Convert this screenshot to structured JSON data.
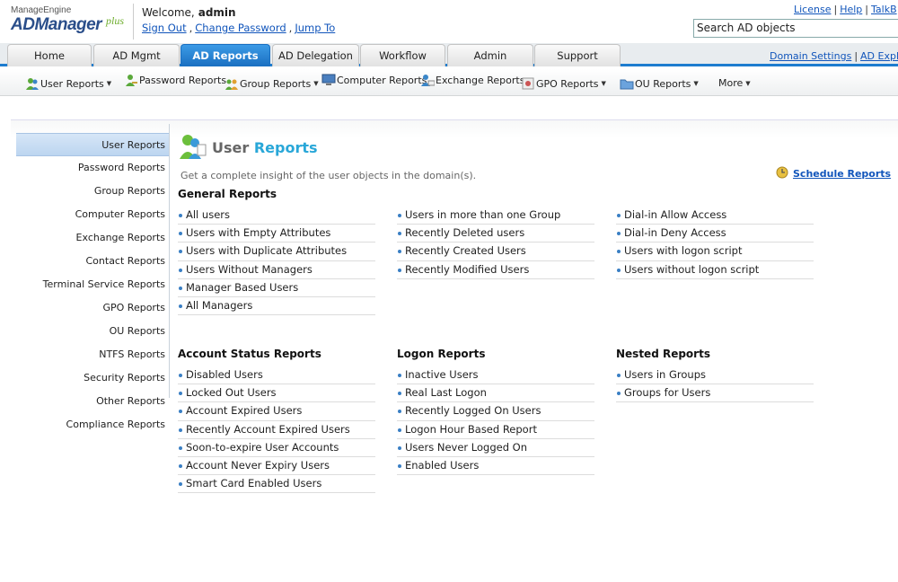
{
  "brand": {
    "company": "ManageEngine",
    "product": "ADManager",
    "edition": "plus"
  },
  "user": {
    "welcome": "Welcome,",
    "name": "admin"
  },
  "account_links": [
    "Sign Out",
    "Change Password",
    "Jump To"
  ],
  "top_links": [
    "License",
    "Help",
    "TalkB"
  ],
  "search": {
    "placeholder": "Search AD objects"
  },
  "tabs": [
    "Home",
    "AD Mgmt",
    "AD Reports",
    "AD Delegation",
    "Workflow",
    "Admin",
    "Support"
  ],
  "active_tab": "AD Reports",
  "tabbar_links": [
    "Domain Settings",
    "AD Explor"
  ],
  "subnav": [
    "User Reports",
    "Password Reports",
    "Group Reports",
    "Computer Reports",
    "Exchange Reports",
    "GPO Reports",
    "OU Reports",
    "More"
  ],
  "sidebar": [
    "User Reports",
    "Password Reports",
    "Group Reports",
    "Computer Reports",
    "Exchange Reports",
    "Contact Reports",
    "Terminal Service Reports",
    "GPO Reports",
    "OU Reports",
    "NTFS Reports",
    "Security Reports",
    "Other Reports",
    "Compliance Reports"
  ],
  "page": {
    "title_part1": "User",
    "title_part2": "Reports",
    "description": "Get a complete insight of the user objects in the domain(s).",
    "schedule_link": "Schedule Reports"
  },
  "sections": {
    "general": {
      "title": "General Reports",
      "col1": [
        "All users",
        "Users with Empty Attributes",
        "Users with Duplicate Attributes",
        "Users Without Managers",
        "Manager Based Users",
        "All Managers"
      ],
      "col2": [
        "Users in more than one Group",
        "Recently Deleted users",
        "Recently Created Users",
        "Recently Modified Users"
      ],
      "col3": [
        "Dial-in Allow Access",
        "Dial-in Deny Access",
        "Users with logon script",
        "Users without logon script"
      ]
    },
    "account_status": {
      "title": "Account Status Reports",
      "items": [
        "Disabled Users",
        "Locked Out Users",
        "Account Expired Users",
        "Recently Account Expired Users",
        "Soon-to-expire User Accounts",
        "Account Never Expiry Users",
        "Smart Card Enabled Users"
      ]
    },
    "logon": {
      "title": "Logon Reports",
      "items": [
        "Inactive Users",
        "Real Last Logon",
        "Recently Logged On Users",
        "Logon Hour Based Report",
        "Users Never Logged On",
        "Enabled Users"
      ]
    },
    "nested": {
      "title": "Nested Reports",
      "items": [
        "Users in Groups",
        "Groups for Users"
      ]
    }
  },
  "colors": {
    "accent": "#1d7ccf",
    "title_blue": "#29a7d8",
    "link": "#1155bb"
  }
}
